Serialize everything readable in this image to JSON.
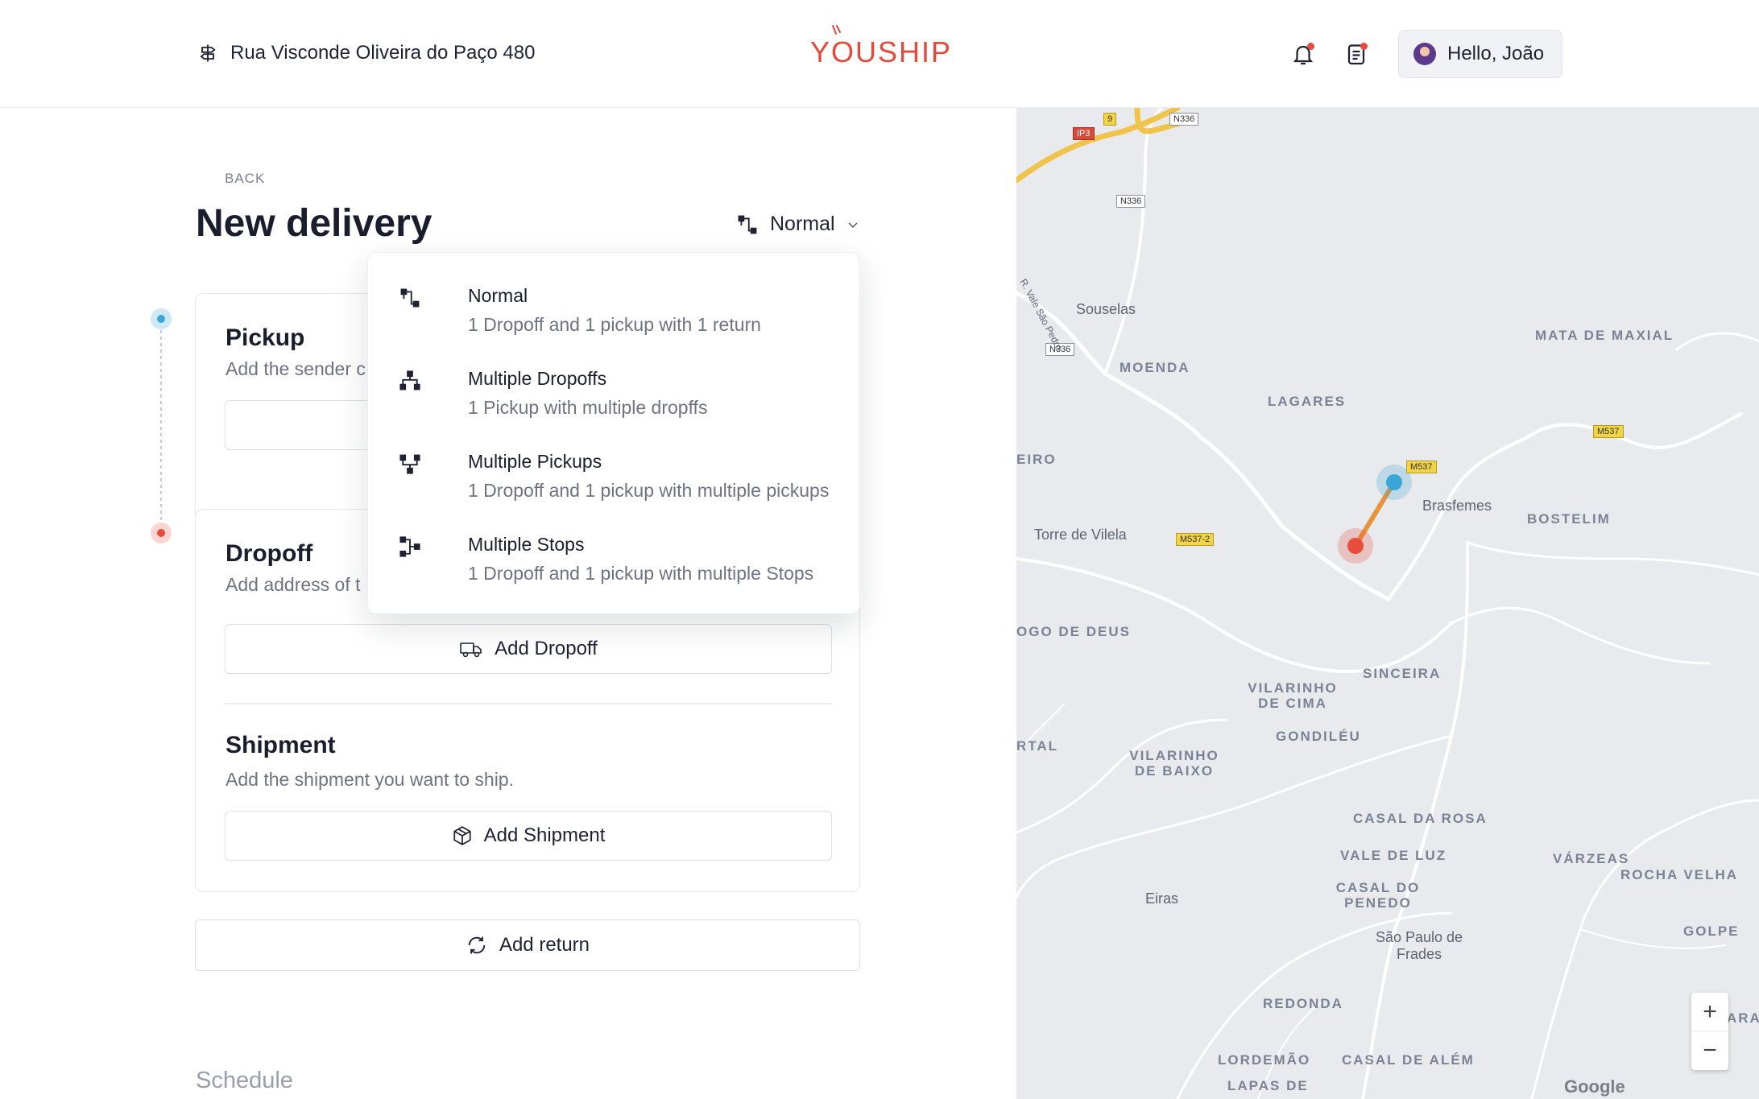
{
  "header": {
    "address": "Rua Visconde Oliveira do Paço 480",
    "logo_text": "YOUSHIP",
    "user_greeting": "Hello, João"
  },
  "page": {
    "back_label": "BACK",
    "title": "New delivery",
    "mode_label": "Normal"
  },
  "pickup": {
    "title": "Pickup",
    "subtitle": "Add the sender c"
  },
  "dropoff": {
    "title": "Dropoff",
    "subtitle": "Add address of t",
    "button_label": "Add Dropoff"
  },
  "shipment": {
    "title": "Shipment",
    "subtitle": "Add the shipment you want to ship.",
    "button_label": "Add Shipment"
  },
  "return_label": "Add return",
  "schedule_label": "Schedule",
  "mode_options": [
    {
      "title": "Normal",
      "description": "1 Dropoff and 1 pickup with 1 return",
      "icon": "normal-flow-icon"
    },
    {
      "title": "Multiple Dropoffs",
      "description": "1 Pickup with multiple dropffs",
      "icon": "multiple-dropoffs-icon"
    },
    {
      "title": "Multiple Pickups",
      "description": "1 Dropoff and 1 pickup with multiple pickups",
      "icon": "multiple-pickups-icon"
    },
    {
      "title": "Multiple Stops",
      "description": "1 Dropoff and 1 pickup with multiple Stops",
      "icon": "multiple-stops-icon"
    }
  ],
  "map": {
    "places": [
      "MATA DE MAXIAL",
      "MOENDA",
      "LAGARES",
      "EIRO",
      "BOSTELIM",
      "OGO DE DEUS",
      "SINCEIRA",
      "VILARINHO DE CIMA",
      "GONDILÉU",
      "RTAL",
      "VILARINHO DE BAIXO",
      "CASAL DA ROSA",
      "VALE DE LUZ",
      "VÁRZEAS",
      "ROCHA VELHA",
      "CASAL DO PENEDO",
      "GOLPE",
      "REDONDA",
      "LORDEMÃO",
      "CASAL DE ALÉM",
      "LAPAS DE",
      "ARA"
    ],
    "towns": [
      "Souselas",
      "Brasfemes",
      "Torre de Vilela",
      "Eiras",
      "São Paulo de Frades",
      "R. Vale São Pedro"
    ],
    "shields": [
      "N336",
      "N336",
      "N336",
      "IP3",
      "9",
      "M537",
      "M537",
      "M537-2"
    ],
    "zoom_in": "+",
    "zoom_out": "−",
    "attribution": "Google",
    "colors": {
      "pickup_pin": "#3aa6d8",
      "dropoff_pin": "#e74c3c",
      "route": "#e8943a",
      "highway": "#f0c34a"
    }
  }
}
